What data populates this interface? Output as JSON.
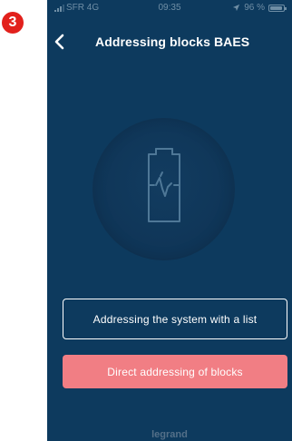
{
  "step_badge": "3",
  "status_bar": {
    "carrier": "SFR 4G",
    "time": "09:35",
    "battery": "96 %",
    "battery_level": 0.96
  },
  "header": {
    "back_icon": "chevron-left-icon",
    "title": "Addressing blocks BAES"
  },
  "illustration": {
    "icon": "clipboard-signal-icon"
  },
  "buttons": {
    "list_label": "Addressing the system with a list",
    "direct_label": "Direct addressing of blocks"
  },
  "footer": {
    "brand": "legrand"
  },
  "colors": {
    "badge": "#e2211c",
    "background": "#0d3a5e",
    "accent_button": "#f17e84",
    "status_text": "#6f8ea5"
  }
}
